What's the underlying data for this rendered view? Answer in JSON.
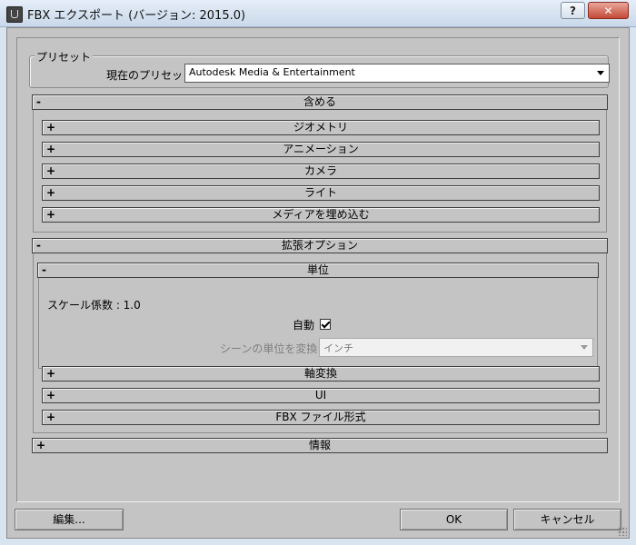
{
  "window": {
    "title": "FBX エクスポート (バージョン: 2015.0)",
    "help_label": "?",
    "close_label": "✕"
  },
  "preset": {
    "group_title": "プリセット",
    "current_label": "現在のプリセット:",
    "current_value": "Autodesk Media & Entertainment"
  },
  "include": {
    "sign": "-",
    "title": "含める",
    "items": [
      {
        "sign": "+",
        "label": "ジオメトリ"
      },
      {
        "sign": "+",
        "label": "アニメーション"
      },
      {
        "sign": "+",
        "label": "カメラ"
      },
      {
        "sign": "+",
        "label": "ライト"
      },
      {
        "sign": "+",
        "label": "メディアを埋め込む"
      }
    ]
  },
  "advanced": {
    "sign": "-",
    "title": "拡張オプション",
    "units": {
      "sign": "-",
      "title": "単位",
      "scale_factor_text": "スケール係数 : 1.0",
      "auto_label": "自動",
      "auto_checked": true,
      "convert_label": "シーンの単位を変換:",
      "convert_value": "インチ"
    },
    "items": [
      {
        "sign": "+",
        "label": "軸変換"
      },
      {
        "sign": "+",
        "label": "UI"
      },
      {
        "sign": "+",
        "label": "FBX ファイル形式"
      }
    ]
  },
  "info": {
    "sign": "+",
    "title": "情報"
  },
  "buttons": {
    "edit_label": "編集...",
    "ok_label": "OK",
    "cancel_label": "キャンセル"
  }
}
